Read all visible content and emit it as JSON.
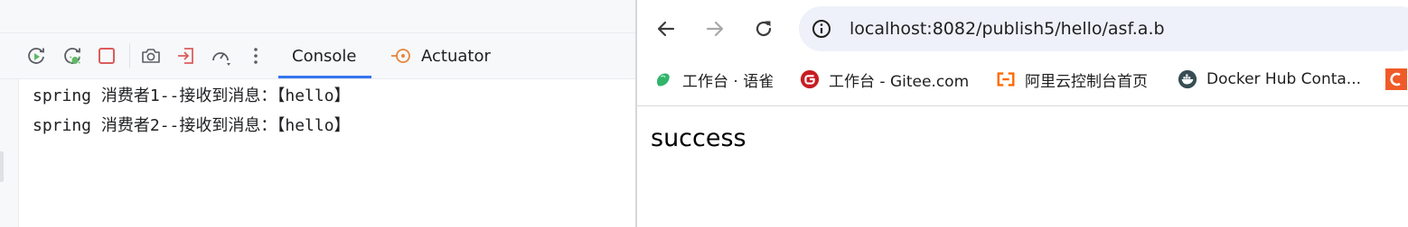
{
  "ide": {
    "toolbar": {
      "icons": [
        "rerun-icon",
        "rerun-debug-icon",
        "stop-icon",
        "camera-icon",
        "exit-icon",
        "gauge-icon",
        "more-icon"
      ]
    },
    "tabs": [
      {
        "label": "Console",
        "active": true
      },
      {
        "label": "Actuator",
        "active": false
      }
    ],
    "console_lines": [
      "spring 消费者1--接收到消息：【hello】",
      "spring 消费者2--接收到消息：【hello】"
    ]
  },
  "browser": {
    "url": "localhost:8082/publish5/hello/asf.a.b",
    "bookmarks": [
      {
        "label": "工作台 · 语雀",
        "icon": "yuque-icon"
      },
      {
        "label": "工作台 - Gitee.com",
        "icon": "gitee-icon"
      },
      {
        "label": "阿里云控制台首页",
        "icon": "aliyun-icon"
      },
      {
        "label": "Docker Hub Conta...",
        "icon": "docker-icon"
      }
    ],
    "page_text": "success"
  },
  "colors": {
    "accent": "#3574f0",
    "stop": "#db5c5c",
    "run_green": "#5fb865",
    "actuator_orange": "#e8853b"
  }
}
